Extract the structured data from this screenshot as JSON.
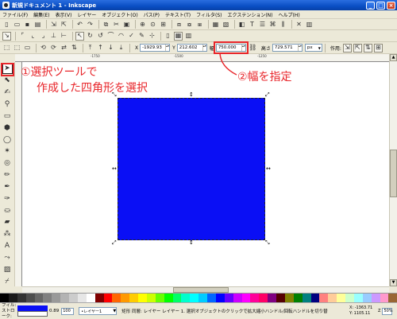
{
  "window": {
    "title": "新規ドキュメント 1 - Inkscape",
    "min": "_",
    "max": "□",
    "close": "×"
  },
  "menu": [
    "ファイル(F)",
    "編集(E)",
    "表示(V)",
    "レイヤー",
    "オブジェクト(O)",
    "パス(P)",
    "テキスト(T)",
    "フィルタ(S)",
    "エクステンション(N)",
    "ヘルプ(H)"
  ],
  "toolbar_controls": {
    "x_label": "X",
    "x_value": "-1929.93",
    "y_label": "Y",
    "y_value": "212.602",
    "w_label": "幅",
    "w_value": "750.000",
    "h_label": "高さ",
    "h_value": "729.571",
    "unit": "px",
    "affect_label": "作用:"
  },
  "ruler_labels": [
    "-1750",
    "-1500",
    "-1250"
  ],
  "annotations": {
    "step1_line1": "①選択ツールで",
    "step1_line2": "作成した四角形を選択",
    "step2": "②幅を指定"
  },
  "status": {
    "fill_label": "フィル:",
    "stroke_label": "ストローク:",
    "opacity_value": "100",
    "stroke_width": "0.89",
    "layer": "•レイヤー1",
    "message": "矩形 同層: レイヤー レイヤー 1. 選択オブジェクトのクリックで拡大縮小ハンドル/回転ハンドルを切り替",
    "coord_x": "X: -1363.71",
    "coord_y": "Y: 1105.11",
    "zoom_label": "Z",
    "zoom_value": "50%"
  },
  "colors": {
    "accent_red": "#e8262b",
    "rect_fill": "#0a0ff5"
  },
  "palette": [
    "#000000",
    "#1a1a1a",
    "#333333",
    "#4d4d4d",
    "#666666",
    "#808080",
    "#999999",
    "#b3b3b3",
    "#cccccc",
    "#e6e6e6",
    "#ffffff",
    "#800000",
    "#ff0000",
    "#ff6600",
    "#ff9900",
    "#ffcc00",
    "#ffff00",
    "#ccff00",
    "#66ff00",
    "#00ff00",
    "#00ff66",
    "#00ffcc",
    "#00ffff",
    "#00ccff",
    "#0066ff",
    "#0000ff",
    "#6600ff",
    "#cc00ff",
    "#ff00ff",
    "#ff0099",
    "#ff0066",
    "#800080",
    "#550000",
    "#808000",
    "#008000",
    "#008080",
    "#000080",
    "#ff8080",
    "#ffcc99",
    "#ffff99",
    "#ccffcc",
    "#99ffff",
    "#99ccff",
    "#cc99ff",
    "#ff99cc",
    "#996633"
  ]
}
